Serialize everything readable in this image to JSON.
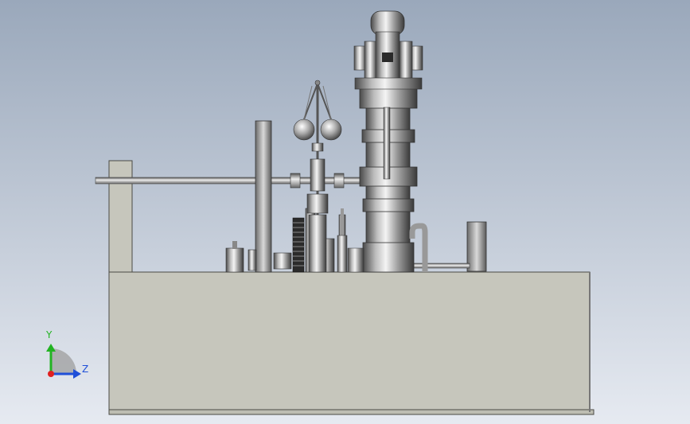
{
  "viewport": {
    "background_top": "#9aa8bb",
    "background_bottom": "#e6eaf1"
  },
  "model": {
    "base_color": "#c6c6bc",
    "base_edge": "#4a4a44",
    "metal_light": "#f0f0f0",
    "metal_dark": "#5a5a5a"
  },
  "triad": {
    "y_label": "Y",
    "z_label": "Z",
    "y_color": "#22b322",
    "z_color": "#1f4fd8",
    "x_color": "#e02020"
  }
}
